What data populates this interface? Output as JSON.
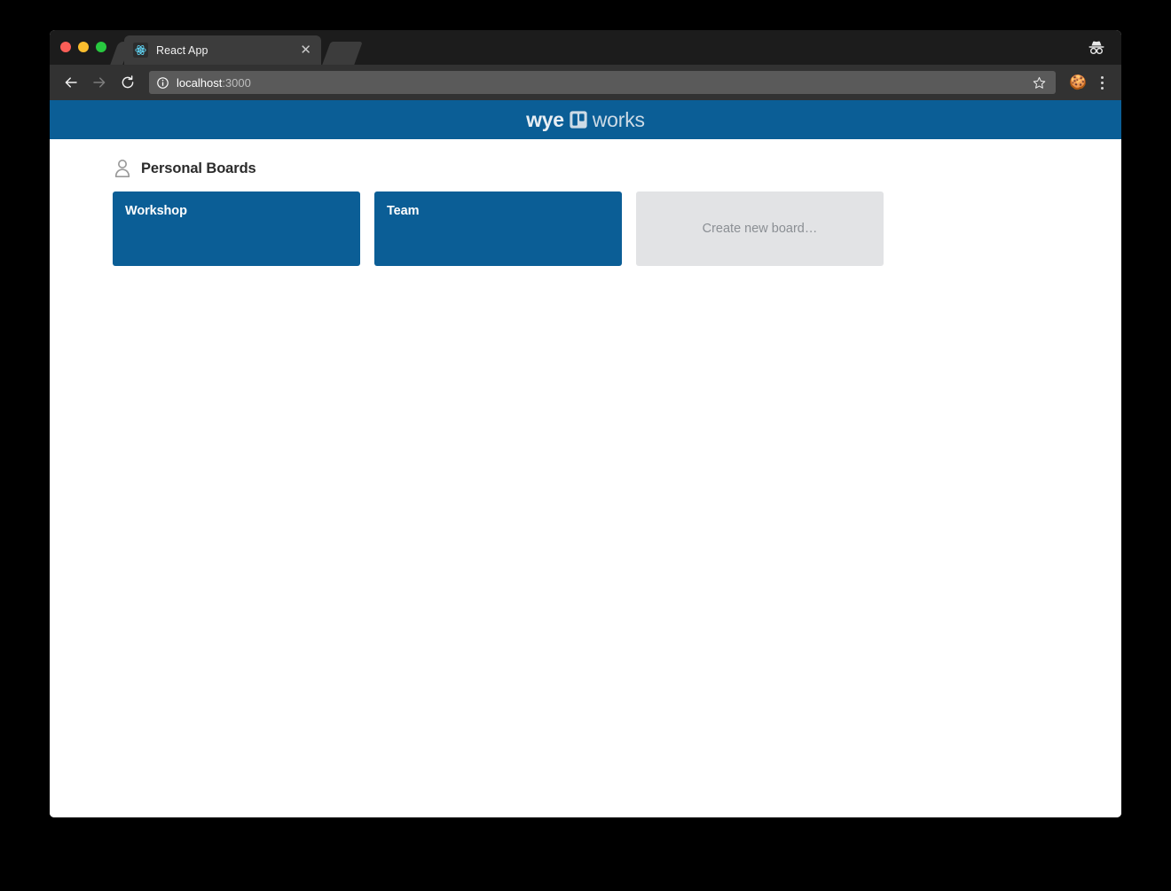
{
  "browser": {
    "tab": {
      "title": "React App",
      "favicon_icon": "react-atom-icon",
      "close_icon": "close-icon"
    },
    "window_controls": {
      "close_label": "close",
      "minimize_label": "minimize",
      "zoom_label": "zoom"
    },
    "toolbar": {
      "back_icon": "back-arrow-icon",
      "forward_icon": "forward-arrow-icon",
      "reload_icon": "reload-icon",
      "site_info_icon": "info-circle-icon",
      "url_host": "localhost",
      "url_port": ":3000",
      "url_full": "localhost:3000",
      "bookmark_icon": "star-icon",
      "extension_icon": "cookie-icon",
      "menu_icon": "three-dot-menu-icon"
    },
    "incognito_icon": "incognito-icon"
  },
  "app": {
    "logo": {
      "text_bold": "wye",
      "mark_icon": "board-columns-icon",
      "text_light": "works",
      "bar_color": "#0b5e96"
    },
    "section": {
      "icon": "person-icon",
      "title": "Personal Boards"
    },
    "boards": [
      {
        "name": "Workshop",
        "color": "#0b5e96"
      },
      {
        "name": "Team",
        "color": "#0b5e96"
      }
    ],
    "create_board": {
      "label": "Create new board…",
      "color": "#e2e3e5"
    }
  }
}
